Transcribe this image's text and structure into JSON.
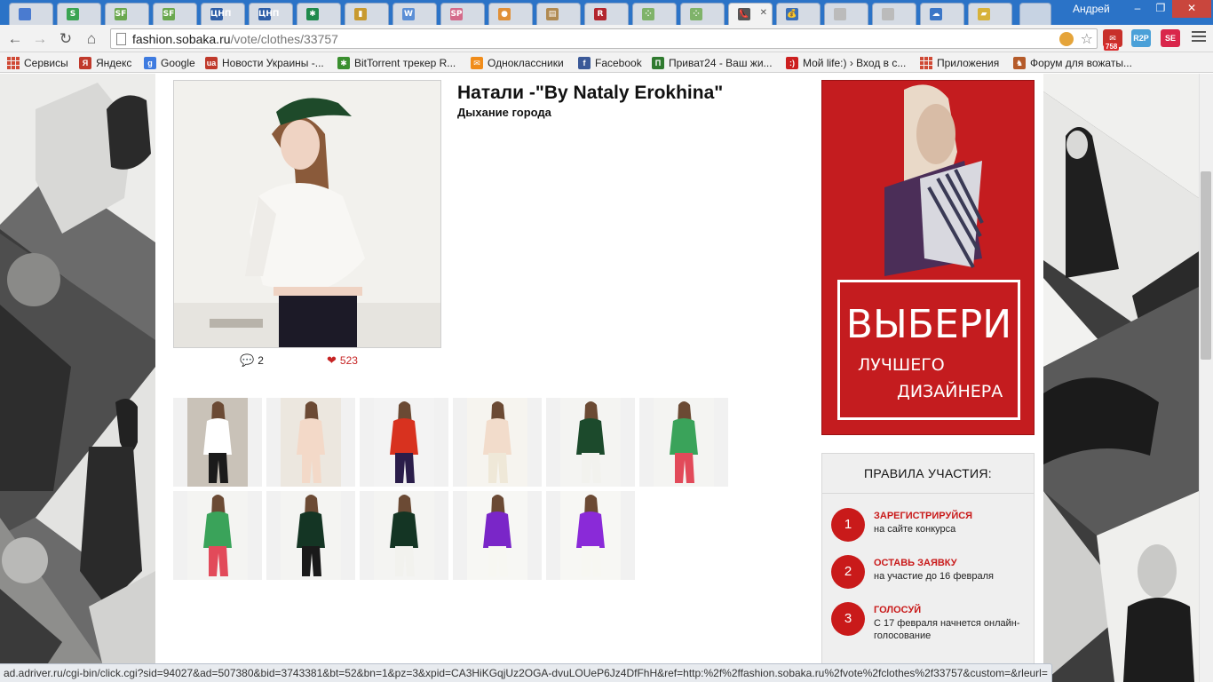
{
  "browser": {
    "user_name": "Андрей",
    "window_controls": [
      "–",
      "❐",
      "✕"
    ],
    "tabs": [
      {
        "icon": "chat-icon",
        "color": "#4a7bd0",
        "glyph": ""
      },
      {
        "icon": "s-logo-icon",
        "color": "#3aa452",
        "glyph": "S"
      },
      {
        "icon": "sf-logo-icon",
        "color": "#6aa84f",
        "glyph": "SF"
      },
      {
        "icon": "sf-logo-icon",
        "color": "#6aa84f",
        "glyph": "SF"
      },
      {
        "icon": "zona-icon",
        "color": "#2f5fa8",
        "glyph": "ЦНП"
      },
      {
        "icon": "zona-icon",
        "color": "#2f5fa8",
        "glyph": "ЦНП"
      },
      {
        "icon": "green-doc-icon",
        "color": "#1f8a4c",
        "glyph": "✱"
      },
      {
        "icon": "chart-icon",
        "color": "#c89a30",
        "glyph": "▮"
      },
      {
        "icon": "w-logo-icon",
        "color": "#5b8fd6",
        "glyph": "W"
      },
      {
        "icon": "sp-logo-icon",
        "color": "#d46a8a",
        "glyph": "SP"
      },
      {
        "icon": "orange-icon",
        "color": "#e09038",
        "glyph": "●"
      },
      {
        "icon": "card-icon",
        "color": "#b08a52",
        "glyph": "▤"
      },
      {
        "icon": "r-logo-icon",
        "color": "#b3262e",
        "glyph": "R"
      },
      {
        "icon": "dots-icon",
        "color": "#7fb36a",
        "glyph": "⁘"
      },
      {
        "icon": "dots-icon",
        "color": "#7fb36a",
        "glyph": "⁘"
      },
      {
        "icon": "shoe-icon",
        "color": "#555555",
        "glyph": "👠",
        "active": true
      },
      {
        "icon": "sack-icon",
        "color": "#3a6fb8",
        "glyph": "💰"
      },
      {
        "icon": "page-icon",
        "color": "#bbbbbb",
        "glyph": ""
      },
      {
        "icon": "page-icon",
        "color": "#bbbbbb",
        "glyph": ""
      },
      {
        "icon": "cloud-icon",
        "color": "#3b76c7",
        "glyph": "☁"
      },
      {
        "icon": "yellow-icon",
        "color": "#d7b23a",
        "glyph": "▰"
      }
    ],
    "url_host": "fashion.sobaka.ru",
    "url_path": "/vote/clothes/33757",
    "extensions": [
      {
        "name": "mail-icon",
        "color": "#c8302a",
        "glyph": "✉",
        "badge": "758"
      },
      {
        "name": "r2p-icon",
        "color": "#4aa0d8",
        "glyph": "R2P",
        "badge": ""
      },
      {
        "name": "se-icon",
        "color": "#d9264b",
        "glyph": "SE",
        "badge": ""
      }
    ],
    "bookmarks": [
      {
        "label": "Сервисы",
        "icon": "apps-grid-icon",
        "color": "#d04a36",
        "glyph": ""
      },
      {
        "label": "Яндекс",
        "icon": "yandex-icon",
        "color": "#c0392b",
        "glyph": "Я"
      },
      {
        "label": "Google",
        "icon": "google-icon",
        "color": "#3e7be0",
        "glyph": "g"
      },
      {
        "label": "Новости Украины -...",
        "icon": "news-icon",
        "color": "#c0392b",
        "glyph": "ua"
      },
      {
        "label": "BitTorrent трекер R...",
        "icon": "torrent-icon",
        "color": "#3a8f2f",
        "glyph": "✱"
      },
      {
        "label": "Одноклассники",
        "icon": "mail-icon",
        "color": "#f08c1a",
        "glyph": "✉"
      },
      {
        "label": "Facebook",
        "icon": "facebook-icon",
        "color": "#3b5998",
        "glyph": "f"
      },
      {
        "label": "Приват24 - Ваш жи...",
        "icon": "privat-icon",
        "color": "#2f7a2f",
        "glyph": "П"
      },
      {
        "label": "Мой life:) › Вход в с...",
        "icon": "life-icon",
        "color": "#cc1f1f",
        "glyph": ":)"
      },
      {
        "label": "Приложения",
        "icon": "apps-grid-icon",
        "color": "#d04a36",
        "glyph": ""
      },
      {
        "label": "Форум для вожаты...",
        "icon": "forum-icon",
        "color": "#b55b2a",
        "glyph": "♞"
      }
    ]
  },
  "entry": {
    "designer": "Натали -\"By Nataly Erokhina\"",
    "collection": "Дыхание города",
    "comments": "2",
    "likes": "523"
  },
  "gallery": {
    "thumbs": [
      {
        "name": "thumb-1",
        "dress": "#ffffff",
        "accent": "#1b1b1b",
        "bg": "#c9c2b8"
      },
      {
        "name": "thumb-2",
        "dress": "#f3d9c8",
        "accent": "#f3d9c8",
        "bg": "#ece7df"
      },
      {
        "name": "thumb-3",
        "dress": "#d8321f",
        "accent": "#2a1d4a",
        "bg": "#f3f3f3"
      },
      {
        "name": "thumb-4",
        "dress": "#f2dccb",
        "accent": "#efe8d8",
        "bg": "#f6f4ef"
      },
      {
        "name": "thumb-5",
        "dress": "#1c4a2c",
        "accent": "#f2f2ee",
        "bg": "#f4f4f2"
      },
      {
        "name": "thumb-6",
        "dress": "#3aa35a",
        "accent": "#e24a5a",
        "bg": "#f4f4f2"
      },
      {
        "name": "thumb-7",
        "dress": "#3aa35a",
        "accent": "#e24a5a",
        "bg": "#f4f4f2"
      },
      {
        "name": "thumb-8",
        "dress": "#143524",
        "accent": "#1a1a1a",
        "bg": "#f4f4f2"
      },
      {
        "name": "thumb-9",
        "dress": "#143524",
        "accent": "#f2f2ee",
        "bg": "#f4f4f2"
      },
      {
        "name": "thumb-10",
        "dress": "#7a26c8",
        "accent": "#f7f7f2",
        "bg": "#f7f7f4"
      },
      {
        "name": "thumb-11",
        "dress": "#8a2ad8",
        "accent": "#f7f7f2",
        "bg": "#f7f7f4"
      }
    ]
  },
  "banner": {
    "headline": "ВЫБЕРИ",
    "line1": "ЛУЧШЕГО",
    "line2": "ДИЗАЙНЕРА",
    "bg_color": "#c41c1f"
  },
  "rules": {
    "title": "ПРАВИЛА УЧАСТИЯ:",
    "items": [
      {
        "num": "1",
        "heading": "ЗАРЕГИСТРИРУЙСЯ",
        "text": "на сайте конкурса"
      },
      {
        "num": "2",
        "heading": "ОСТАВЬ ЗАЯВКУ",
        "text": "на участие до 16 февраля"
      },
      {
        "num": "3",
        "heading": "ГОЛОСУЙ",
        "text": "С 17 февраля начнется онлайн-голосование"
      }
    ]
  },
  "status_url": "ad.adriver.ru/cgi-bin/click.cgi?sid=94027&ad=507380&bid=3743381&bt=52&bn=1&pz=3&xpid=CA3HiKGqjUz2OGA-dvuLOUeP6Jz4DfFhH&ref=http:%2f%2ffashion.sobaka.ru%2fvote%2fclothes%2f33757&custom=&rleurl="
}
